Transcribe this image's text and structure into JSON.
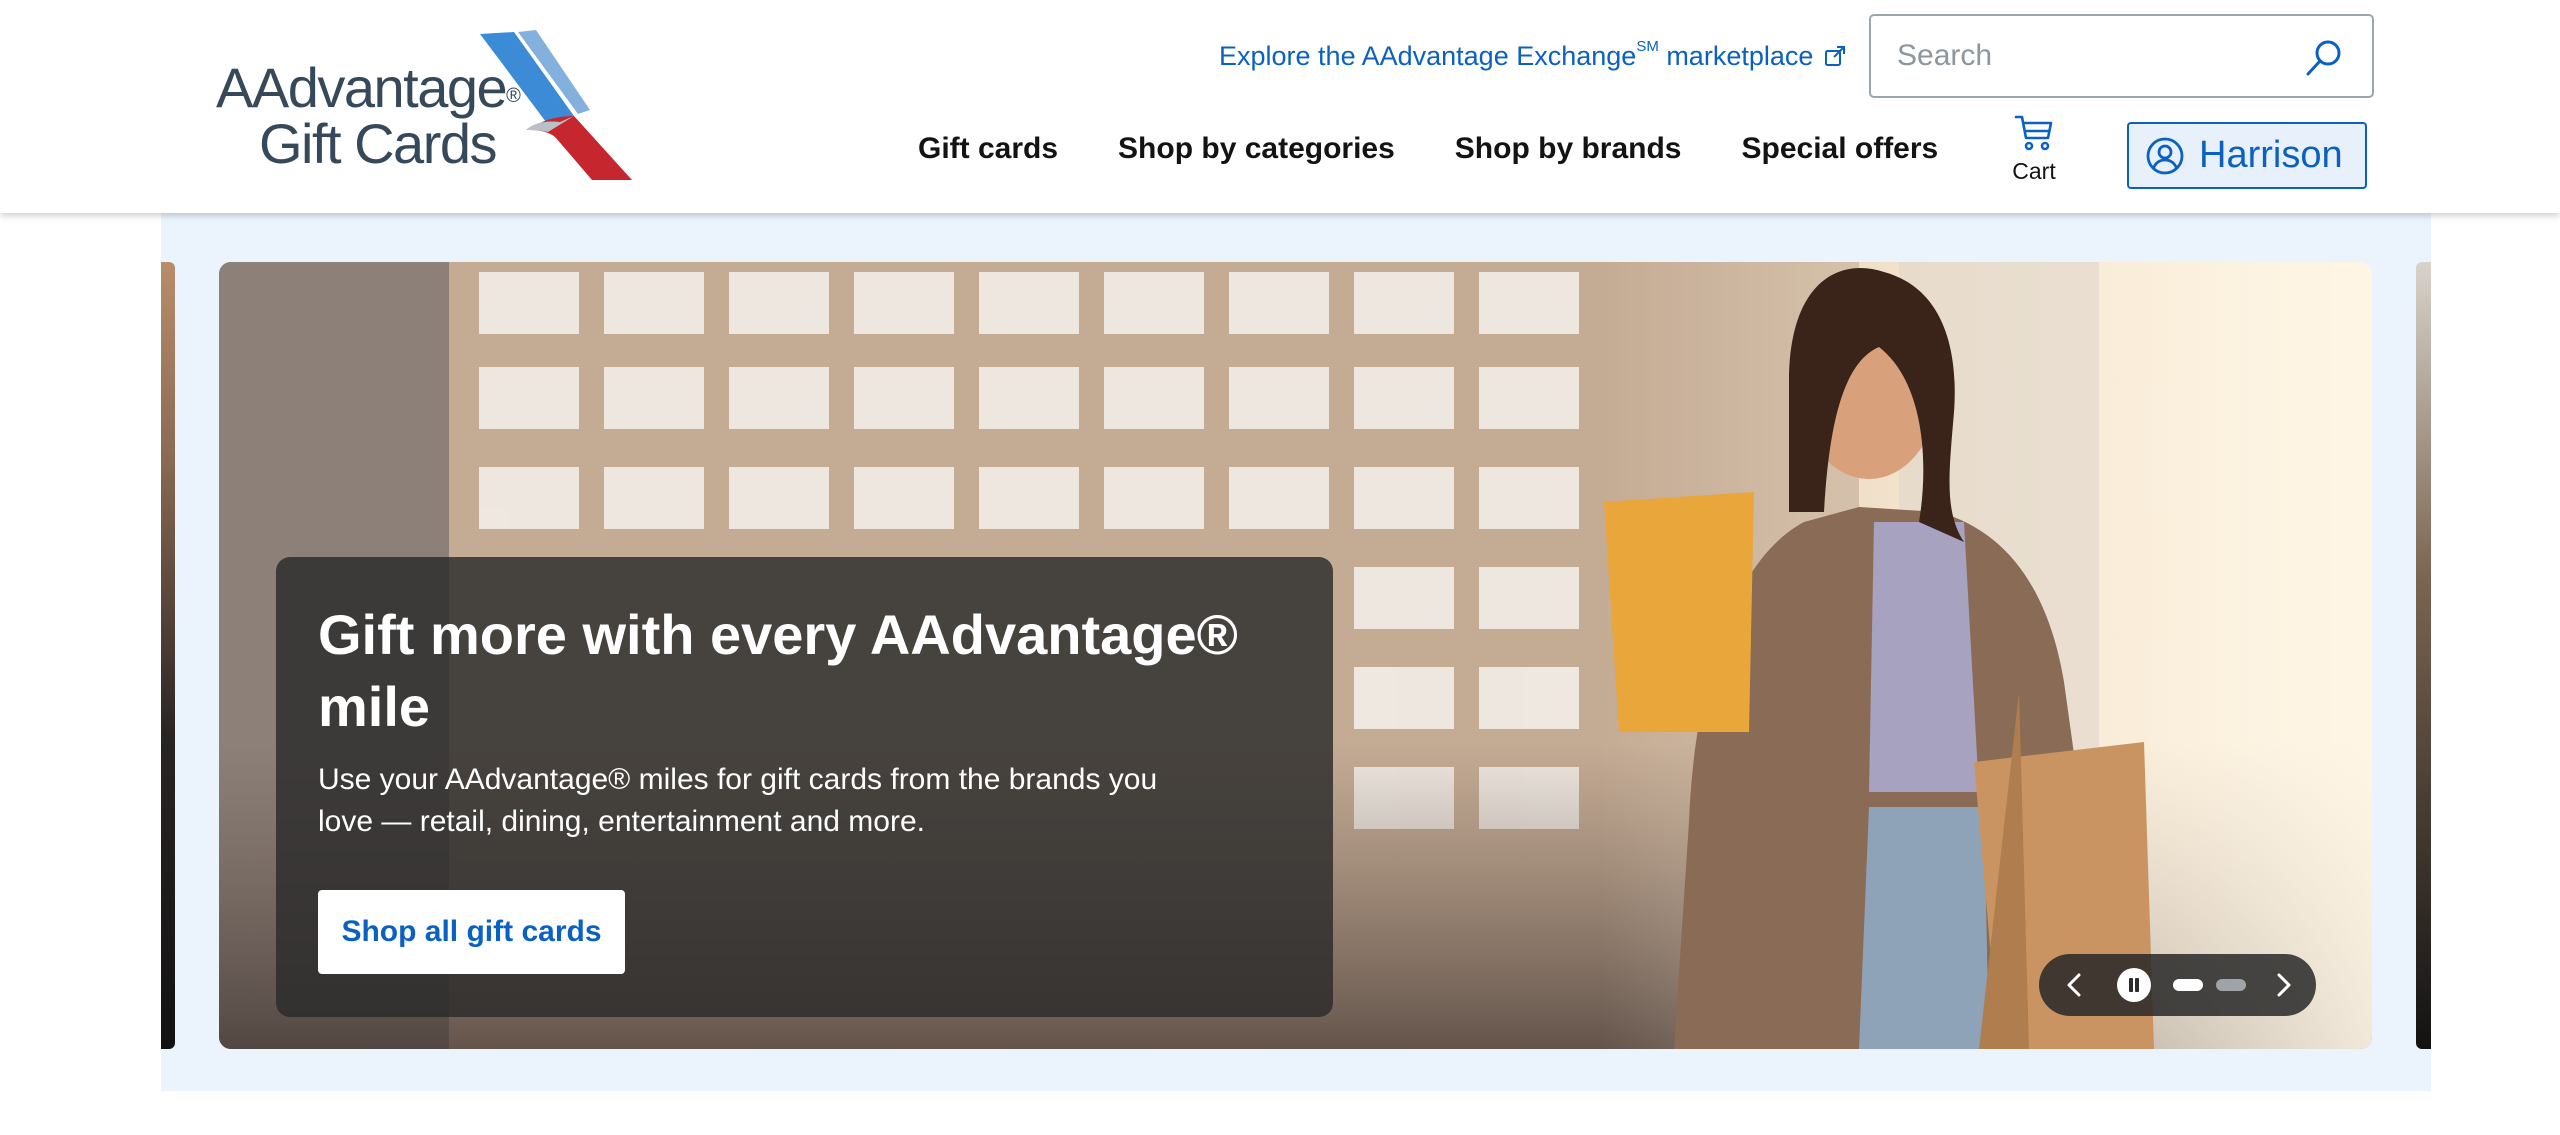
{
  "header": {
    "logo": {
      "line1": "AAdvantage",
      "reg": "®",
      "line2": "Gift Cards"
    },
    "explore_link": {
      "text": "Explore the AAdvantage Exchange",
      "sup": "SM",
      "text_after": " marketplace"
    },
    "search": {
      "placeholder": "Search",
      "value": ""
    },
    "nav": [
      {
        "label": "Gift cards"
      },
      {
        "label": "Shop by categories"
      },
      {
        "label": "Shop by brands"
      },
      {
        "label": "Special offers"
      }
    ],
    "cart_label": "Cart",
    "account_name": "Harrison"
  },
  "hero": {
    "heading": "Gift more with every AAdvantage® mile",
    "body": "Use your AAdvantage® miles for gift cards from the brands you love — retail, dining, entertainment and more.",
    "cta_label": "Shop all gift cards",
    "carousel": {
      "current_slide": 1,
      "total_slides": 2
    }
  },
  "colors": {
    "brand_blue": "#0b61c2",
    "logo_gray": "#36495a",
    "logo_blue": "#3b8bd6",
    "logo_red": "#c6262e",
    "hero_band": "#ebf3fd",
    "promo_overlay": "#2b2b2b"
  },
  "icons": {
    "external_link": "external-link-icon",
    "search": "search-icon",
    "cart": "cart-icon",
    "account": "user-circle-icon",
    "prev": "chevron-left-icon",
    "next": "chevron-right-icon",
    "pause": "pause-icon"
  }
}
